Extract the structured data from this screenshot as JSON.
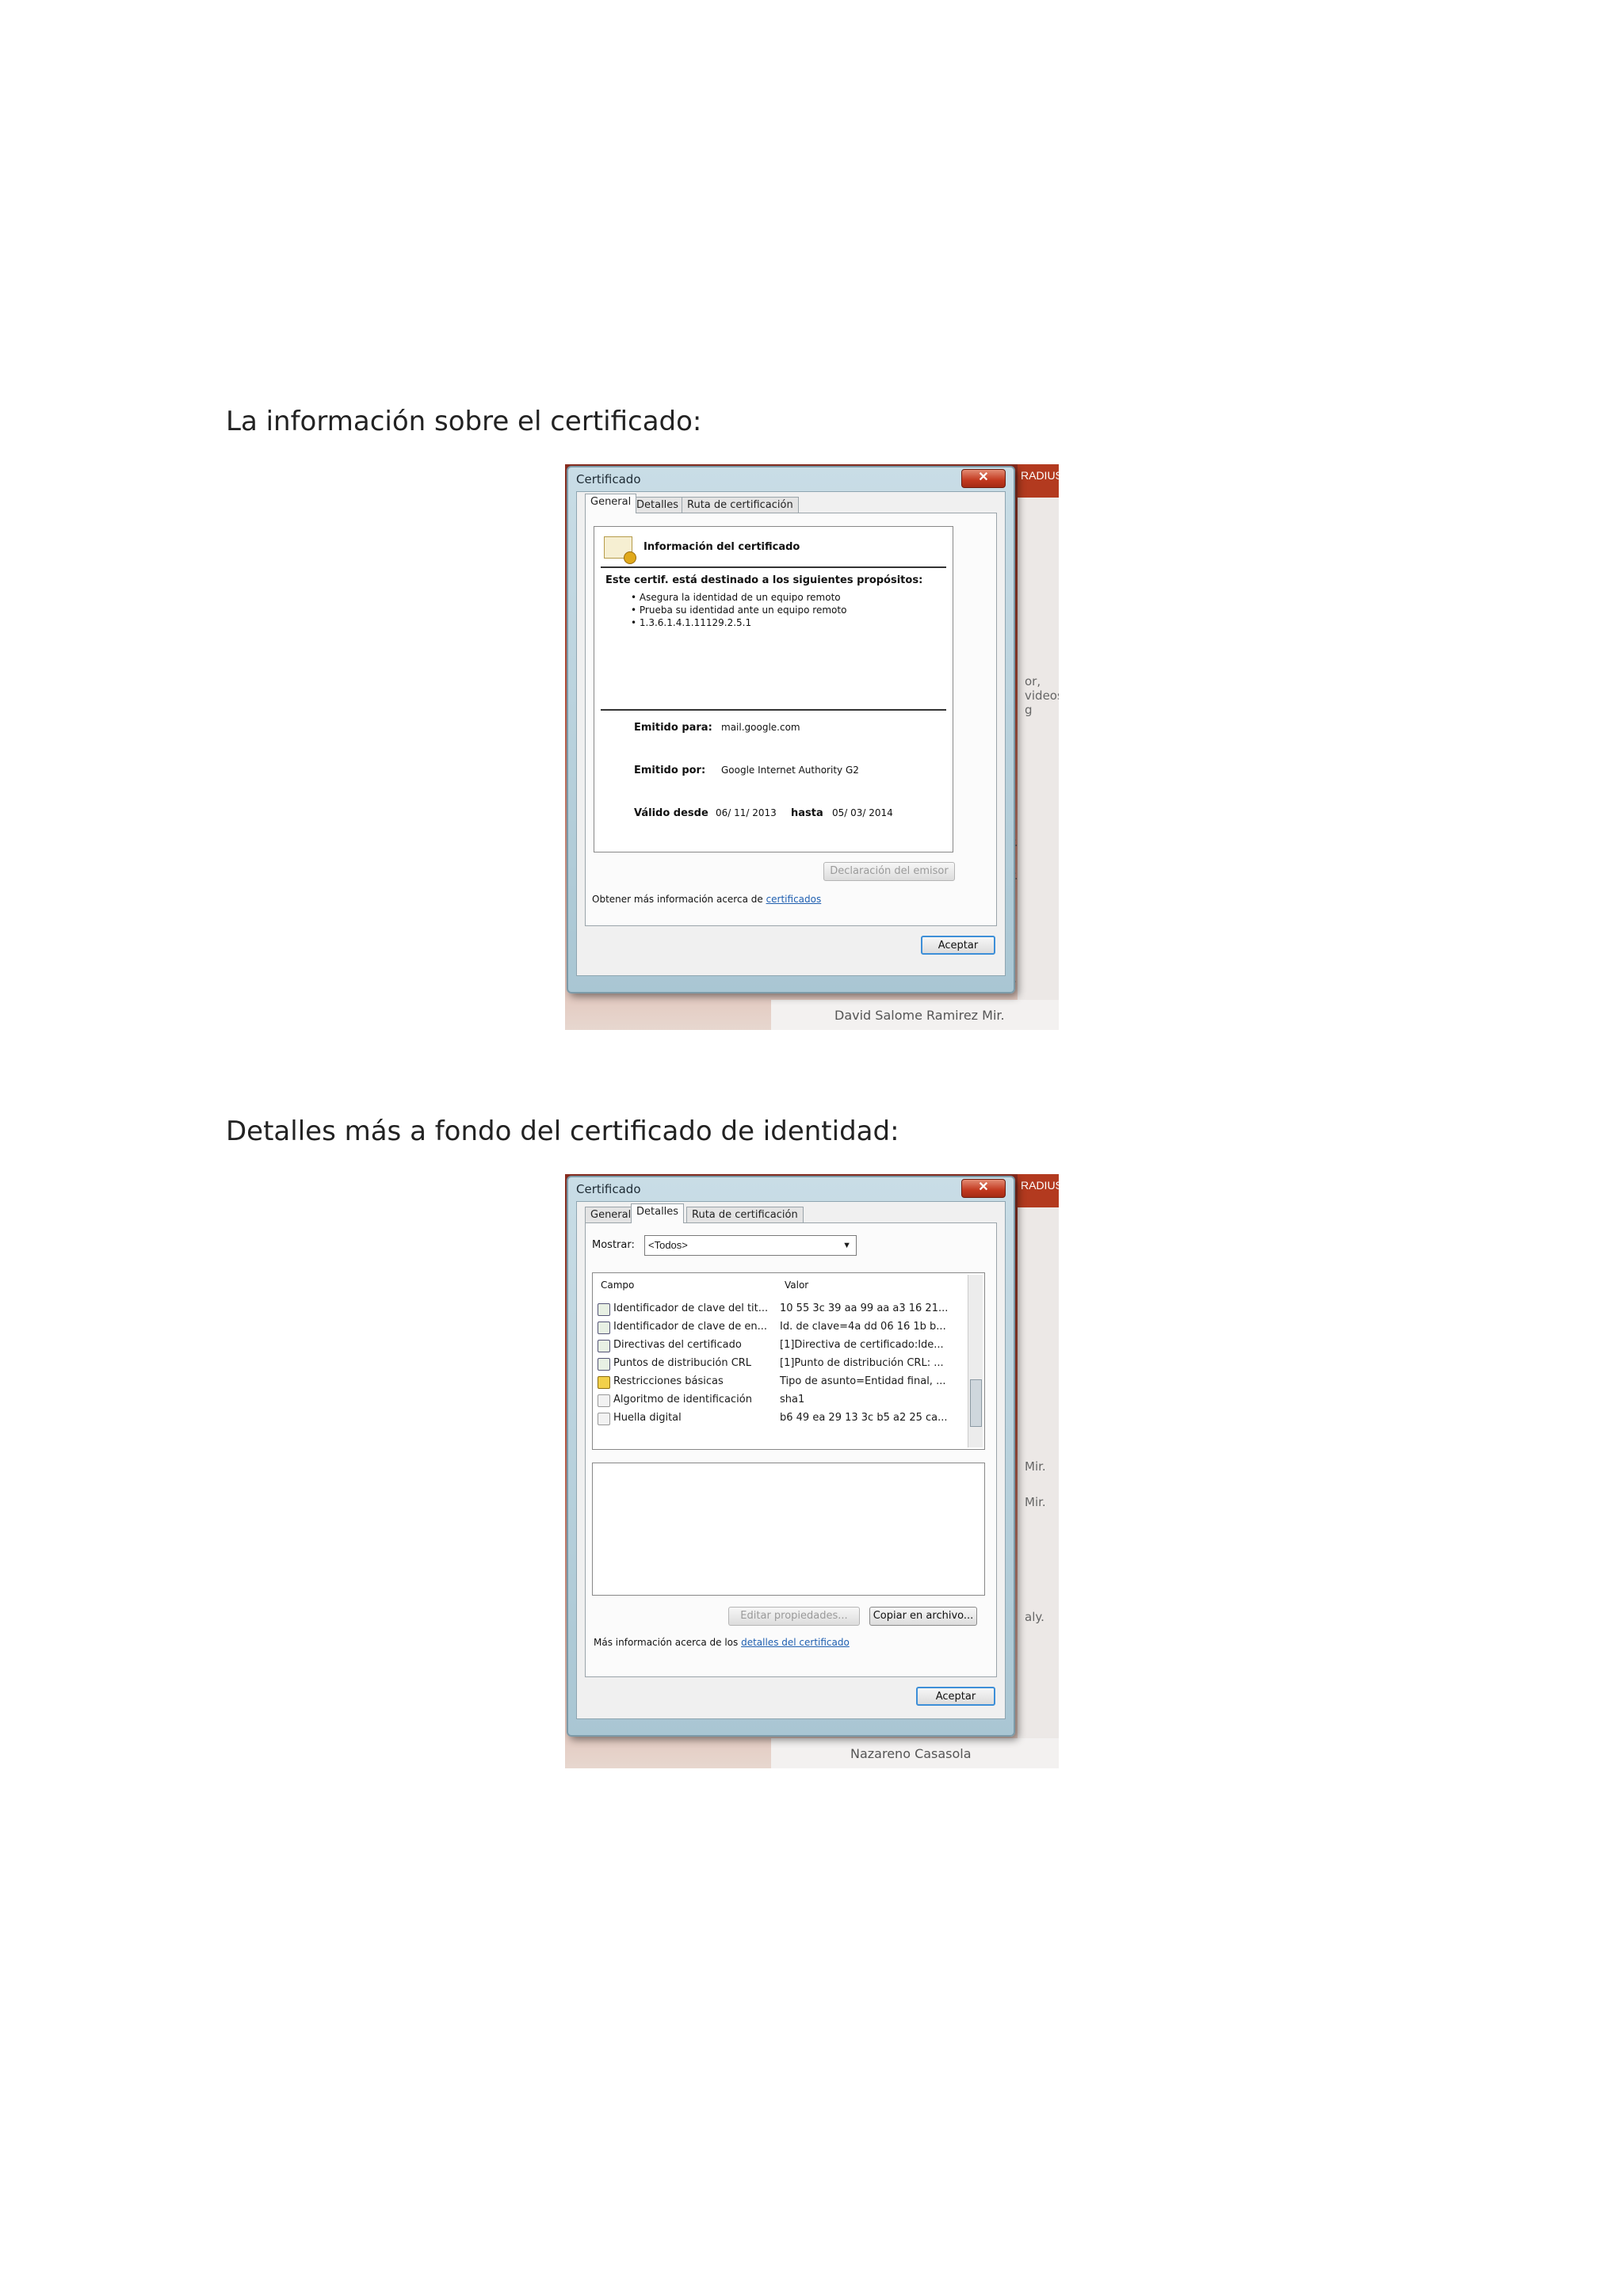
{
  "captions": {
    "first": "La información sobre el certificado:",
    "second": "Detalles más a fondo del certificado de identidad:"
  },
  "dialog1": {
    "title": "Certificado",
    "close_symbol": "✕",
    "tabs": [
      "General",
      "Detalles",
      "Ruta de certificación"
    ],
    "heading": "Información del certificado",
    "purposes_title": "Este certif. está destinado a los siguientes propósitos:",
    "purposes": [
      "• Asegura la identidad de un equipo remoto",
      "• Prueba su identidad ante un equipo remoto",
      "• 1.3.6.1.4.1.11129.2.5.1"
    ],
    "issued_to_label": "Emitido para:",
    "issued_to": "mail.google.com",
    "issued_by_label": "Emitido por:",
    "issued_by": "Google Internet Authority G2",
    "valid_from_label": "Válido desde",
    "valid_from": "06/ 11/ 2013",
    "valid_to_label": "hasta",
    "valid_to": "05/ 03/ 2014",
    "issuer_statement_button": "Declaración del emisor",
    "more_info_text": "Obtener más información acerca de",
    "more_info_link": "certificados",
    "ok_button": "Aceptar"
  },
  "dialog2": {
    "title": "Certificado",
    "close_symbol": "✕",
    "tabs": [
      "General",
      "Detalles",
      "Ruta de certificación"
    ],
    "show_label": "Mostrar:",
    "show_value": "<Todos>",
    "columns": [
      "Campo",
      "Valor"
    ],
    "rows": [
      {
        "field": "Identificador de clave del tit...",
        "value": "10 55 3c 39 aa 99 aa a3 16 21..."
      },
      {
        "field": "Identificador de clave de en...",
        "value": "Id. de clave=4a dd 06 16 1b b..."
      },
      {
        "field": "Directivas del certificado",
        "value": "[1]Directiva de certificado:Ide..."
      },
      {
        "field": "Puntos de distribución CRL",
        "value": "[1]Punto de distribución CRL: ..."
      },
      {
        "field": "Restricciones básicas",
        "value": "Tipo de asunto=Entidad final, ..."
      },
      {
        "field": "Algoritmo de identificación",
        "value": "sha1"
      },
      {
        "field": "Huella digital",
        "value": "b6 49 ea 29 13 3c b5 a2 25 ca..."
      }
    ],
    "edit_properties_button": "Editar propiedades...",
    "copy_to_file_button": "Copiar en archivo...",
    "more_info_text": "Más información acerca de los",
    "more_info_link": "detalles del certificado",
    "ok_button": "Aceptar"
  },
  "background": {
    "tab_label": "RADIUS",
    "close_mark": "×",
    "videos_text": "or, videos g",
    "mir_1": "Mir.",
    "mir_2": "Mir.",
    "aly": "aly.",
    "sender1": "David Salome Ramirez Mir.",
    "sender2": "Nazareno Casasola"
  }
}
